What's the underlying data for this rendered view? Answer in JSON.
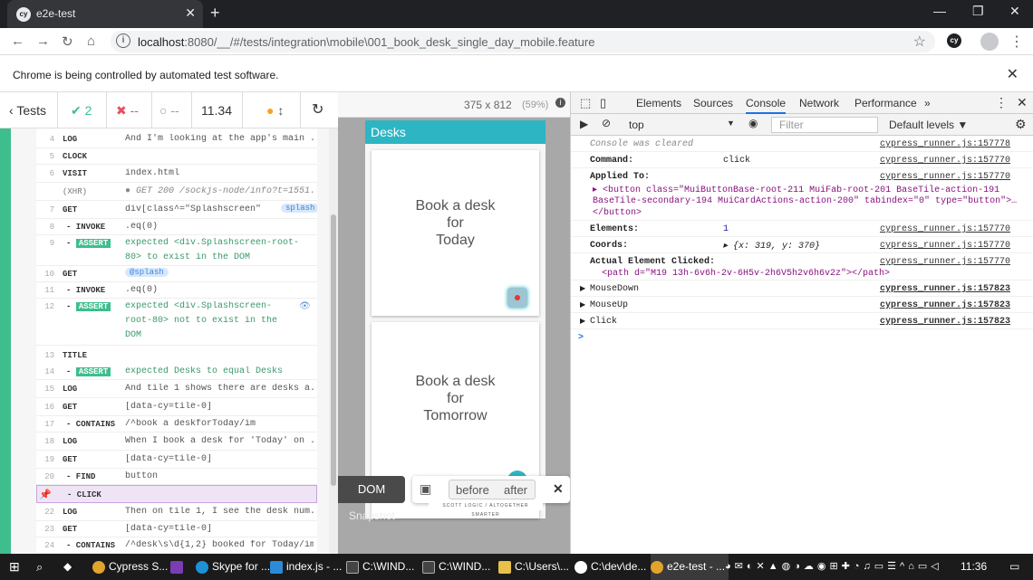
{
  "browser": {
    "tab_title": "e2e-test",
    "tab_close": "✕",
    "new_tab": "+",
    "url_host": "localhost",
    "url_rest": ":8080/__/#/tests/integration\\mobile\\001_book_desk_single_day_mobile.feature",
    "infobar_text": "Chrome is being controlled by automated test software.",
    "logo_text": "cy"
  },
  "cypress": {
    "tests_label": "Tests",
    "passed": "2",
    "failed": "--",
    "pending": "--",
    "duration": "11.34",
    "commands": [
      {
        "num": "4",
        "name": "LOG",
        "msg": "And I'm looking at the app's main ..."
      },
      {
        "num": "5",
        "name": "CLOCK",
        "msg": ""
      },
      {
        "num": "6",
        "name": "VISIT",
        "msg": "index.html"
      },
      {
        "num": "",
        "name": "(XHR)",
        "msg": "● GET 200 /sockjs-node/info?t=1551..."
      },
      {
        "num": "7",
        "name": "GET",
        "msg": "div[class^=\"Splashscreen\"]",
        "pill": "splash"
      },
      {
        "num": "8",
        "name": "- INVOKE",
        "msg": ".eq(0)"
      },
      {
        "num": "9",
        "name": "- ASSERT",
        "msg1": "expected <div.Splashscreen-root-",
        "msg2": "80> to exist in the DOM"
      },
      {
        "num": "10",
        "name": "GET",
        "pill": "@splash"
      },
      {
        "num": "11",
        "name": "- INVOKE",
        "msg": ".eq(0)"
      },
      {
        "num": "12",
        "name": "- ASSERT",
        "msg1": "expected <div.Splashscreen-",
        "msg2": "root-80> not to exist in the",
        "msg3": "DOM"
      },
      {
        "num": "13",
        "name": "TITLE",
        "msg": ""
      },
      {
        "num": "14",
        "name": "- ASSERT",
        "msg": "expected Desks to equal Desks"
      },
      {
        "num": "15",
        "name": "LOG",
        "msg": "And tile 1 shows there are desks a..."
      },
      {
        "num": "16",
        "name": "GET",
        "msg": "[data-cy=tile-0]"
      },
      {
        "num": "17",
        "name": "- CONTAINS",
        "msg": "/^book a deskforToday/im"
      },
      {
        "num": "18",
        "name": "LOG",
        "msg": "When I book a desk for 'Today' on ..."
      },
      {
        "num": "19",
        "name": "GET",
        "msg": "[data-cy=tile-0]"
      },
      {
        "num": "20",
        "name": "- FIND",
        "msg": "button"
      },
      {
        "num": "",
        "name": "- CLICK",
        "msg": ""
      },
      {
        "num": "22",
        "name": "LOG",
        "msg": "Then on tile 1, I see the desk num..."
      },
      {
        "num": "23",
        "name": "GET",
        "msg": "[data-cy=tile-0]"
      },
      {
        "num": "24",
        "name": "- CONTAINS",
        "msg": "/^desk\\s\\d{1,2} booked for Today/im"
      }
    ]
  },
  "viewport": {
    "size": "375 x 812",
    "scale": "(59%)",
    "app_title": "Desks",
    "card1": [
      "Book a desk",
      "for",
      "Today"
    ],
    "card2": [
      "Book a desk",
      "for",
      "Tomorrow"
    ],
    "dom_label": "DOM",
    "before": "before",
    "after": "after",
    "snapshot": "Snapshot",
    "footer_brand": "SCOTT LOGIC  /  ALTOGETHER SMARTER"
  },
  "devtools": {
    "tabs": [
      "Elements",
      "Sources",
      "Console",
      "Network",
      "Performance"
    ],
    "context": "top",
    "filter_placeholder": "Filter",
    "levels": "Default levels ▼",
    "lines": {
      "cleared": "Console was cleared",
      "src1": "cypress_runner.js:157778",
      "command_lab": "Command:",
      "command_val": "click",
      "src2": "cypress_runner.js:157770",
      "applied_lab": "Applied To:",
      "src3": "cypress_runner.js:157770",
      "applied_l1": "<button class=\"MuiButtonBase-root-211 MuiFab-root-201 BaseTile-action-191",
      "applied_l2": "BaseTile-secondary-194 MuiCardActions-action-200\" tabindex=\"0\" type=\"button\">…",
      "applied_l3": "</button>",
      "elements_lab": "Elements:",
      "elements_val": "1",
      "src4": "cypress_runner.js:157770",
      "coords_lab": "Coords:",
      "coords_val": "{x: 319, y: 370}",
      "src5": "cypress_runner.js:157770",
      "actual_lab": "Actual Element Clicked:",
      "src6": "cypress_runner.js:157770",
      "actual_val": "<path d=\"M19 13h-6v6h-2v-6H5v-2h6V5h2v6h6v2z\"></path>",
      "mousedown": "MouseDown",
      "src7": "cypress_runner.js:157823",
      "mouseup": "MouseUp",
      "src8": "cypress_runner.js:157823",
      "click": "Click",
      "src9": "cypress_runner.js:157823",
      "prompt": ">"
    }
  },
  "taskbar": {
    "items": [
      "Cypress S...",
      "Skype for ...",
      "index.js - ...",
      "C:\\WIND...",
      "C:\\WIND...",
      "C:\\Users\\...",
      "C:\\dev\\de...",
      "e2e-test - ..."
    ],
    "time": "11:36"
  }
}
